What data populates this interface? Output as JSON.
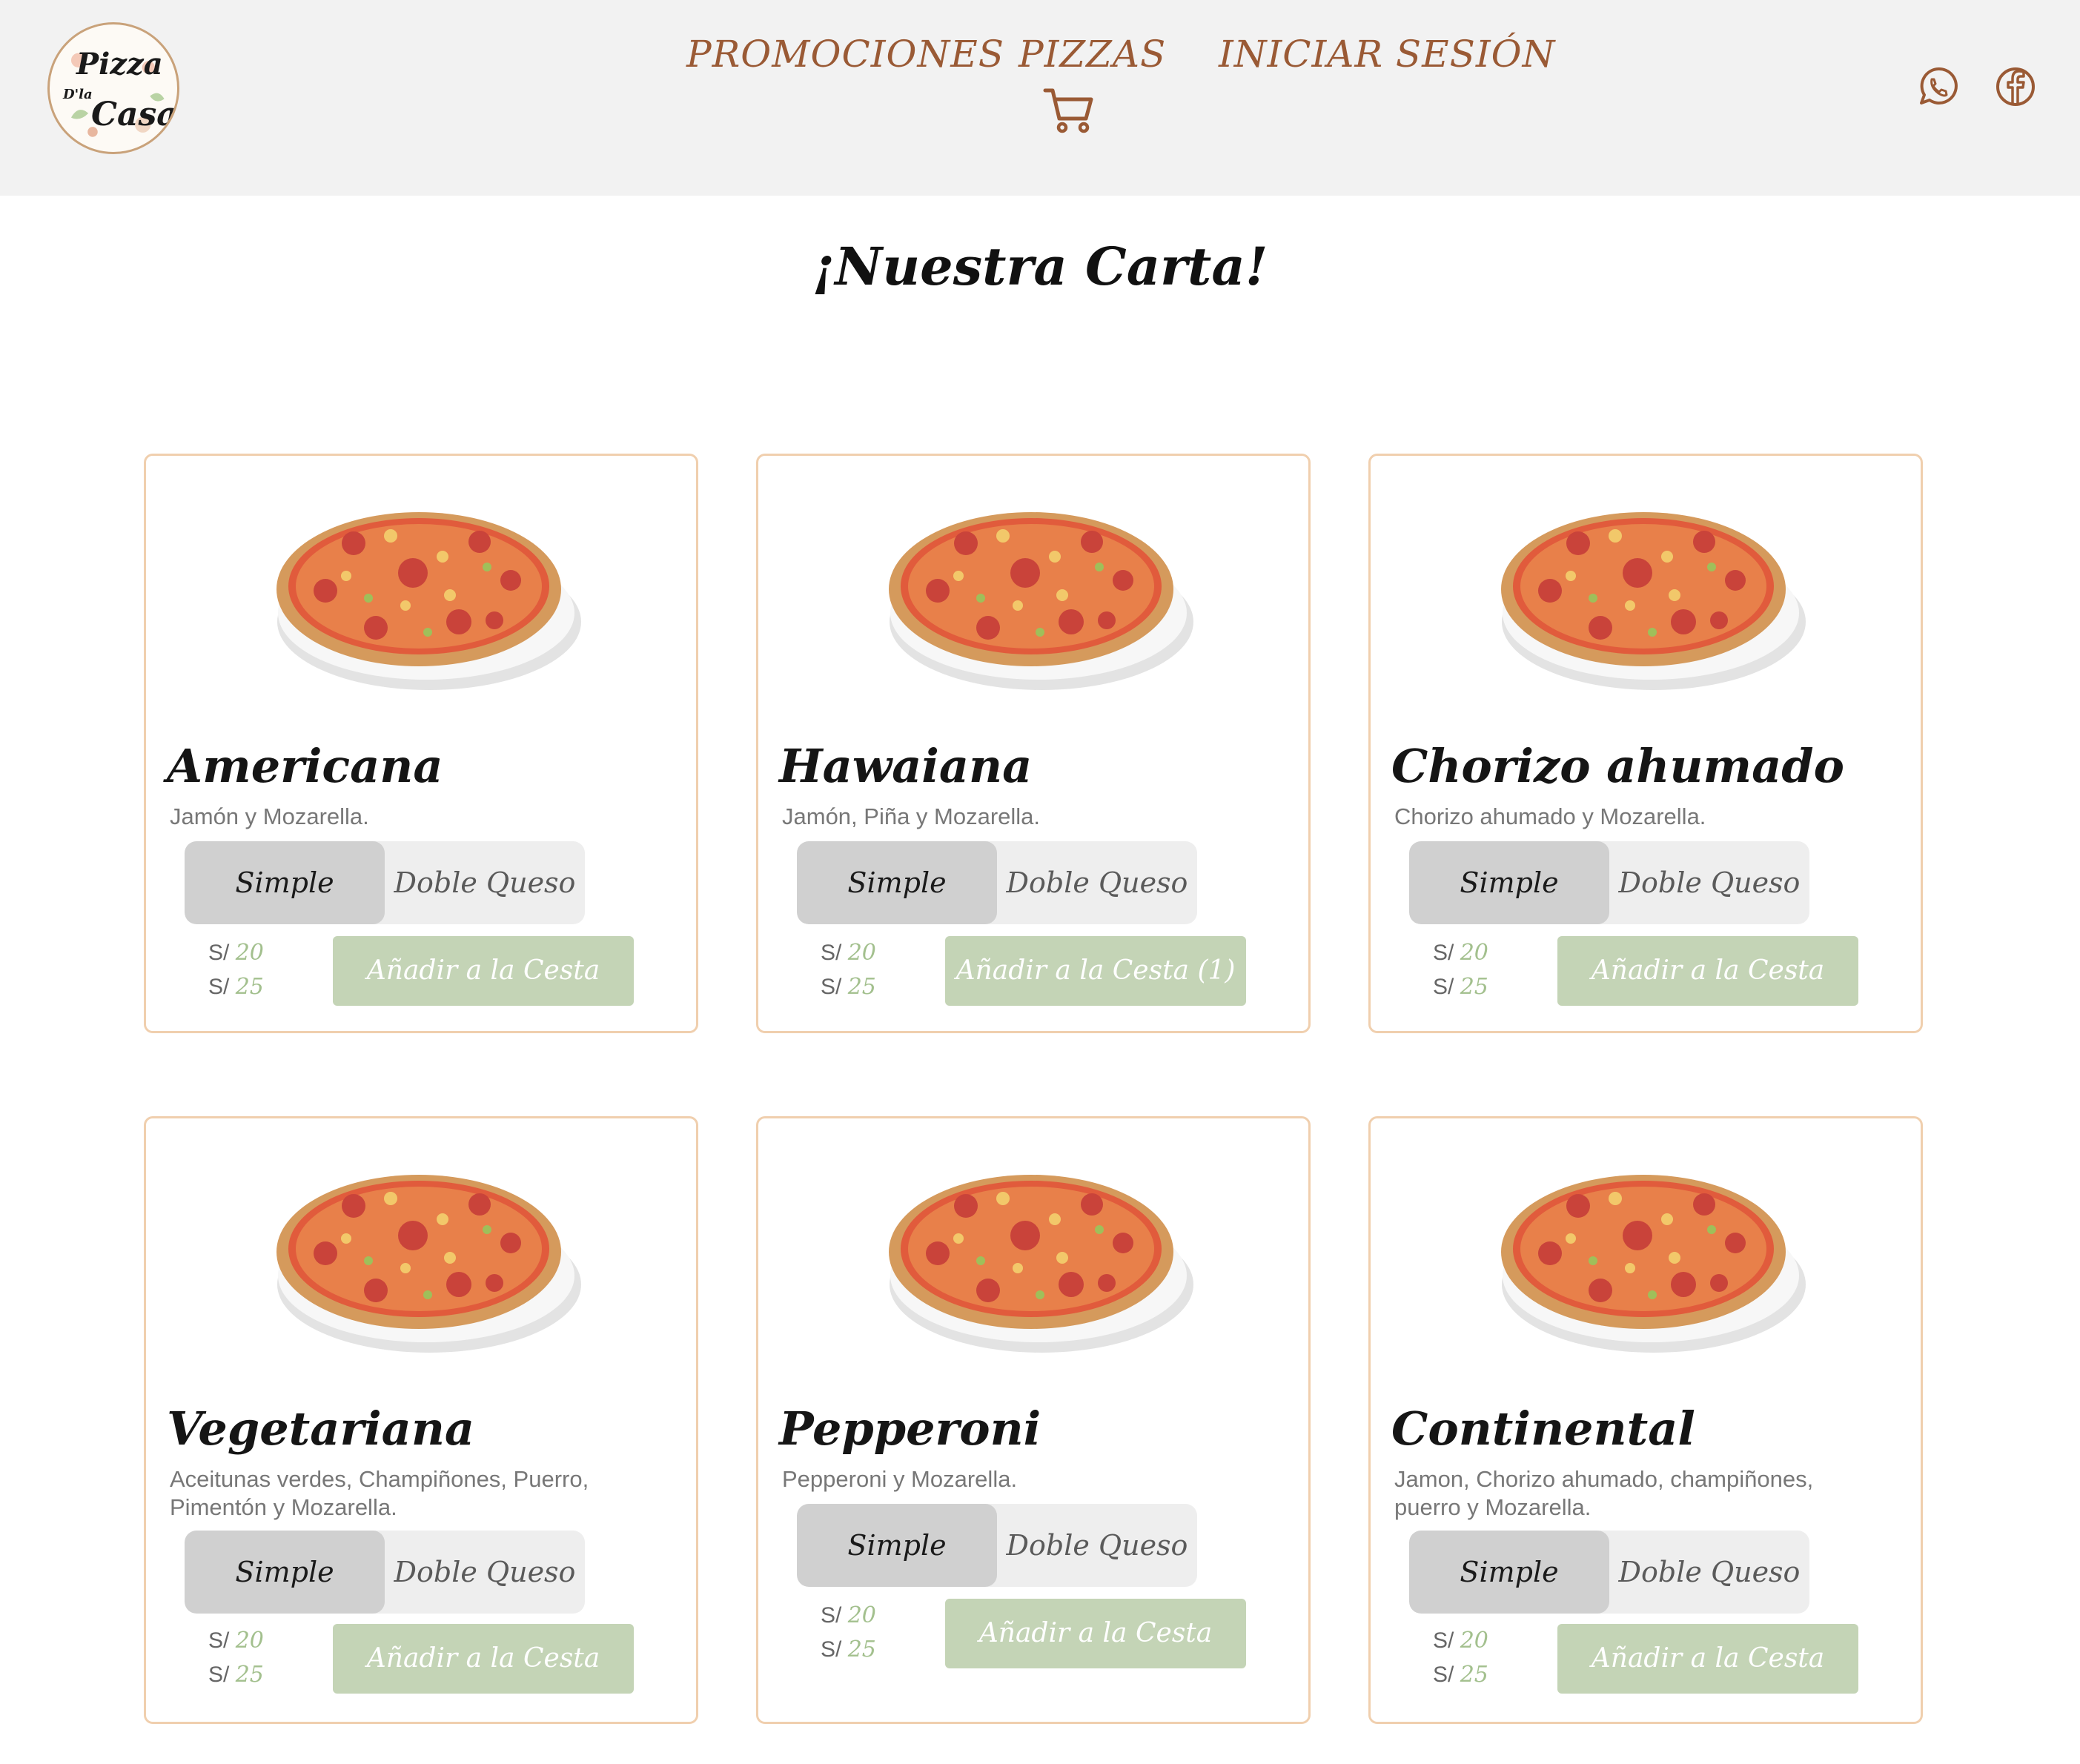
{
  "brand": {
    "line1": "Pizza",
    "line2": "D'la",
    "line3": "Casa"
  },
  "nav": {
    "promociones": "PROMOCIONES",
    "pizzas": "PIZZAS",
    "login": "INICIAR SESIÓN"
  },
  "icons": {
    "cart": "shopping-cart-icon",
    "whatsapp": "whatsapp-icon",
    "facebook": "facebook-icon"
  },
  "colors": {
    "header_bg": "#f2f2f2",
    "nav_text": "#9a5a35",
    "card_border": "#f0cfae",
    "button_bg": "#c4d4b6",
    "price_accent": "#a3c08e"
  },
  "title": "¡Nuestra Carta!",
  "options": {
    "simple": "Simple",
    "doble": "Doble Queso"
  },
  "currency": "S/",
  "pizzas": [
    {
      "name": "Americana",
      "description": "Jamón y Mozarella.",
      "price_simple": "20",
      "price_doble": "25",
      "button": "Añadir a la Cesta"
    },
    {
      "name": "Hawaiana",
      "description": "Jamón, Piña y Mozarella.",
      "price_simple": "20",
      "price_doble": "25",
      "button": "Añadir a la Cesta (1)"
    },
    {
      "name": "Chorizo ahumado",
      "description": "Chorizo ahumado y Mozarella.",
      "price_simple": "20",
      "price_doble": "25",
      "button": "Añadir a la Cesta"
    },
    {
      "name": "Vegetariana",
      "description": "Aceitunas verdes, Champiñones, Puerro, Pimentón y Mozarella.",
      "price_simple": "20",
      "price_doble": "25",
      "button": "Añadir a la Cesta"
    },
    {
      "name": "Pepperoni",
      "description": "Pepperoni y Mozarella.",
      "price_simple": "20",
      "price_doble": "25",
      "button": "Añadir a la Cesta"
    },
    {
      "name": "Continental",
      "description": "Jamon, Chorizo ahumado, champiñones, puerro y Mozarella.",
      "price_simple": "20",
      "price_doble": "25",
      "button": "Añadir a la Cesta"
    }
  ]
}
